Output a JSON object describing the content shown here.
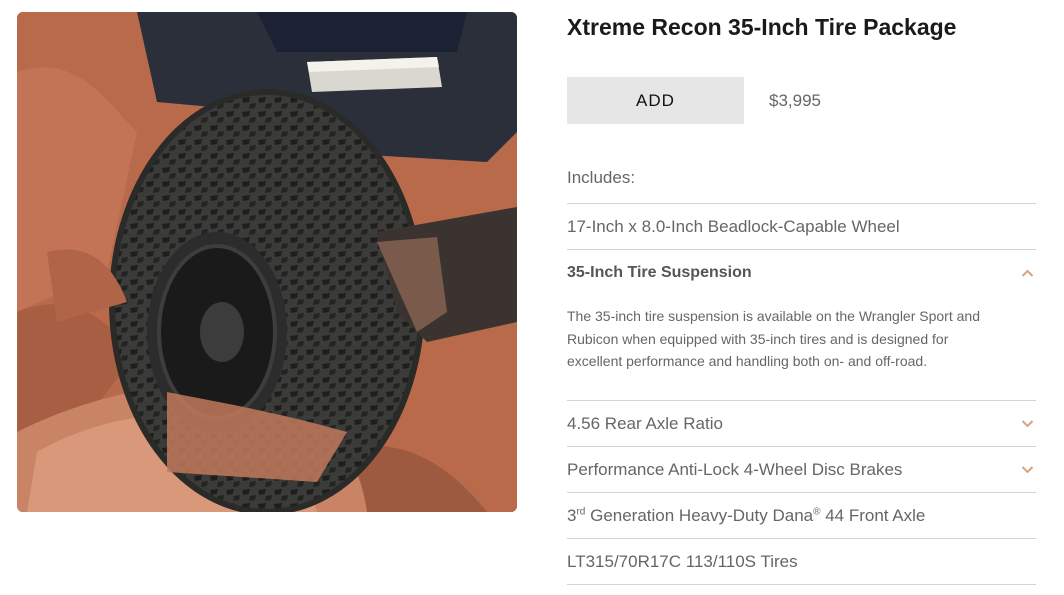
{
  "product": {
    "title": "Xtreme Recon 35-Inch Tire Package",
    "add_label": "ADD",
    "price": "$3,995",
    "includes_label": "Includes:"
  },
  "includes": {
    "wheel": "17-Inch x 8.0-Inch Beadlock-Capable Wheel",
    "suspension": {
      "title": "35-Inch Tire Suspension",
      "description_lines": [
        "The 35-inch tire suspension is available on the Wrangler Sport and",
        "Rubicon when equipped with 35-inch tires and is designed for",
        "excellent performance and handling both on- and off-road."
      ]
    },
    "axle_ratio": "4.56 Rear Axle Ratio",
    "brakes": "Performance Anti-Lock 4-Wheel Disc Brakes",
    "front_axle": {
      "number": "3",
      "superscript": "rd",
      "text_before_mark": " Generation Heavy-Duty Dana",
      "mark": "®",
      "text_after_mark": " 44 Front Axle"
    },
    "tires": "LT315/70R17C 113/110S Tires"
  },
  "icons": {
    "expanded": "chevron-up-icon",
    "collapsed": "chevron-down-icon"
  },
  "colors": {
    "chevron": "#d9a37f",
    "button_bg": "#e6e6e6",
    "divider": "#d4d4d4"
  }
}
